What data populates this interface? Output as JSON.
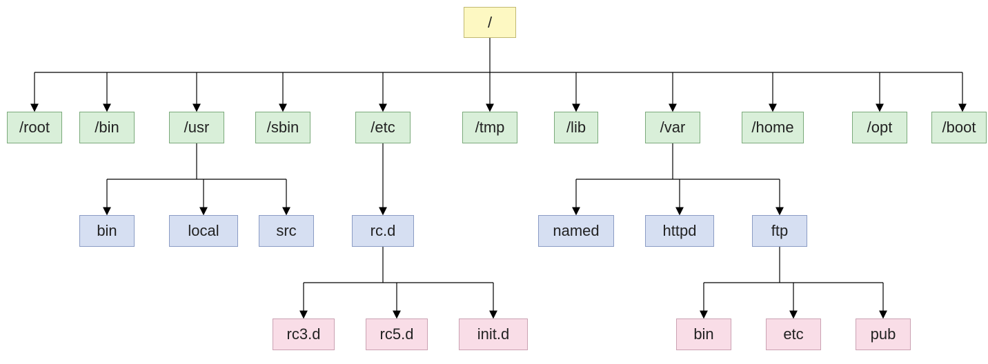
{
  "tree": {
    "root": {
      "label": "/"
    },
    "level1": [
      {
        "id": "root",
        "label": "/root"
      },
      {
        "id": "bin",
        "label": "/bin"
      },
      {
        "id": "usr",
        "label": "/usr"
      },
      {
        "id": "sbin",
        "label": "/sbin"
      },
      {
        "id": "etc",
        "label": "/etc"
      },
      {
        "id": "tmp",
        "label": "/tmp"
      },
      {
        "id": "lib",
        "label": "/lib"
      },
      {
        "id": "var",
        "label": "/var"
      },
      {
        "id": "home",
        "label": "/home"
      },
      {
        "id": "opt",
        "label": "/opt"
      },
      {
        "id": "boot",
        "label": "/boot"
      }
    ],
    "level2": {
      "usr": [
        {
          "id": "usr-bin",
          "label": "bin"
        },
        {
          "id": "usr-local",
          "label": "local"
        },
        {
          "id": "usr-src",
          "label": "src"
        }
      ],
      "etc": [
        {
          "id": "etc-rcd",
          "label": "rc.d"
        }
      ],
      "var": [
        {
          "id": "var-named",
          "label": "named"
        },
        {
          "id": "var-httpd",
          "label": "httpd"
        },
        {
          "id": "var-ftp",
          "label": "ftp"
        }
      ]
    },
    "level3": {
      "etc-rcd": [
        {
          "id": "rc3d",
          "label": "rc3.d"
        },
        {
          "id": "rc5d",
          "label": "rc5.d"
        },
        {
          "id": "initd",
          "label": "init.d"
        }
      ],
      "var-ftp": [
        {
          "id": "ftp-bin",
          "label": "bin"
        },
        {
          "id": "ftp-etc",
          "label": "etc"
        },
        {
          "id": "ftp-pub",
          "label": "pub"
        }
      ]
    }
  }
}
